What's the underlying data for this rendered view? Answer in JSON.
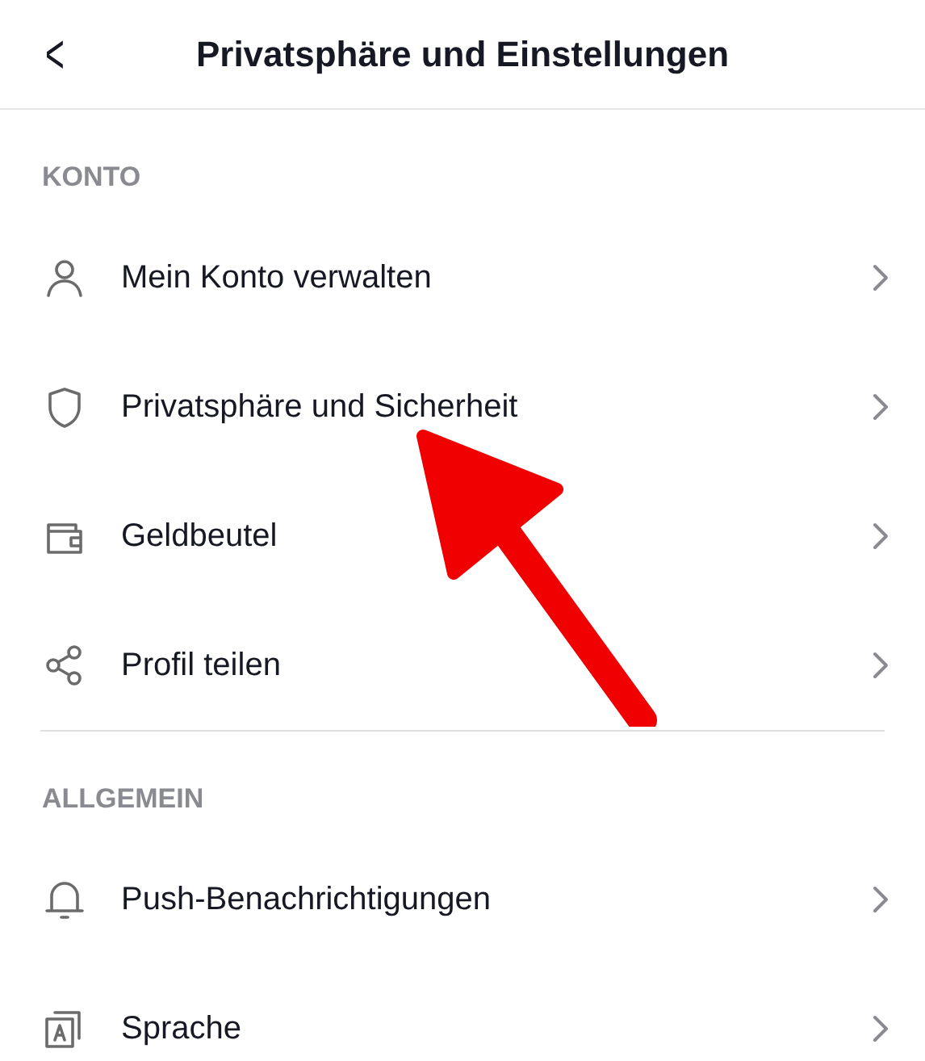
{
  "header": {
    "back": "<",
    "title": "Privatsphäre und Einstellungen"
  },
  "sections": [
    {
      "title": "KONTO",
      "items": [
        {
          "label": "Mein Konto verwalten"
        },
        {
          "label": "Privatsphäre und Sicherheit"
        },
        {
          "label": "Geldbeutel"
        },
        {
          "label": "Profil teilen"
        }
      ]
    },
    {
      "title": "ALLGEMEIN",
      "items": [
        {
          "label": "Push-Benachrichtigungen"
        },
        {
          "label": "Sprache"
        }
      ]
    }
  ]
}
